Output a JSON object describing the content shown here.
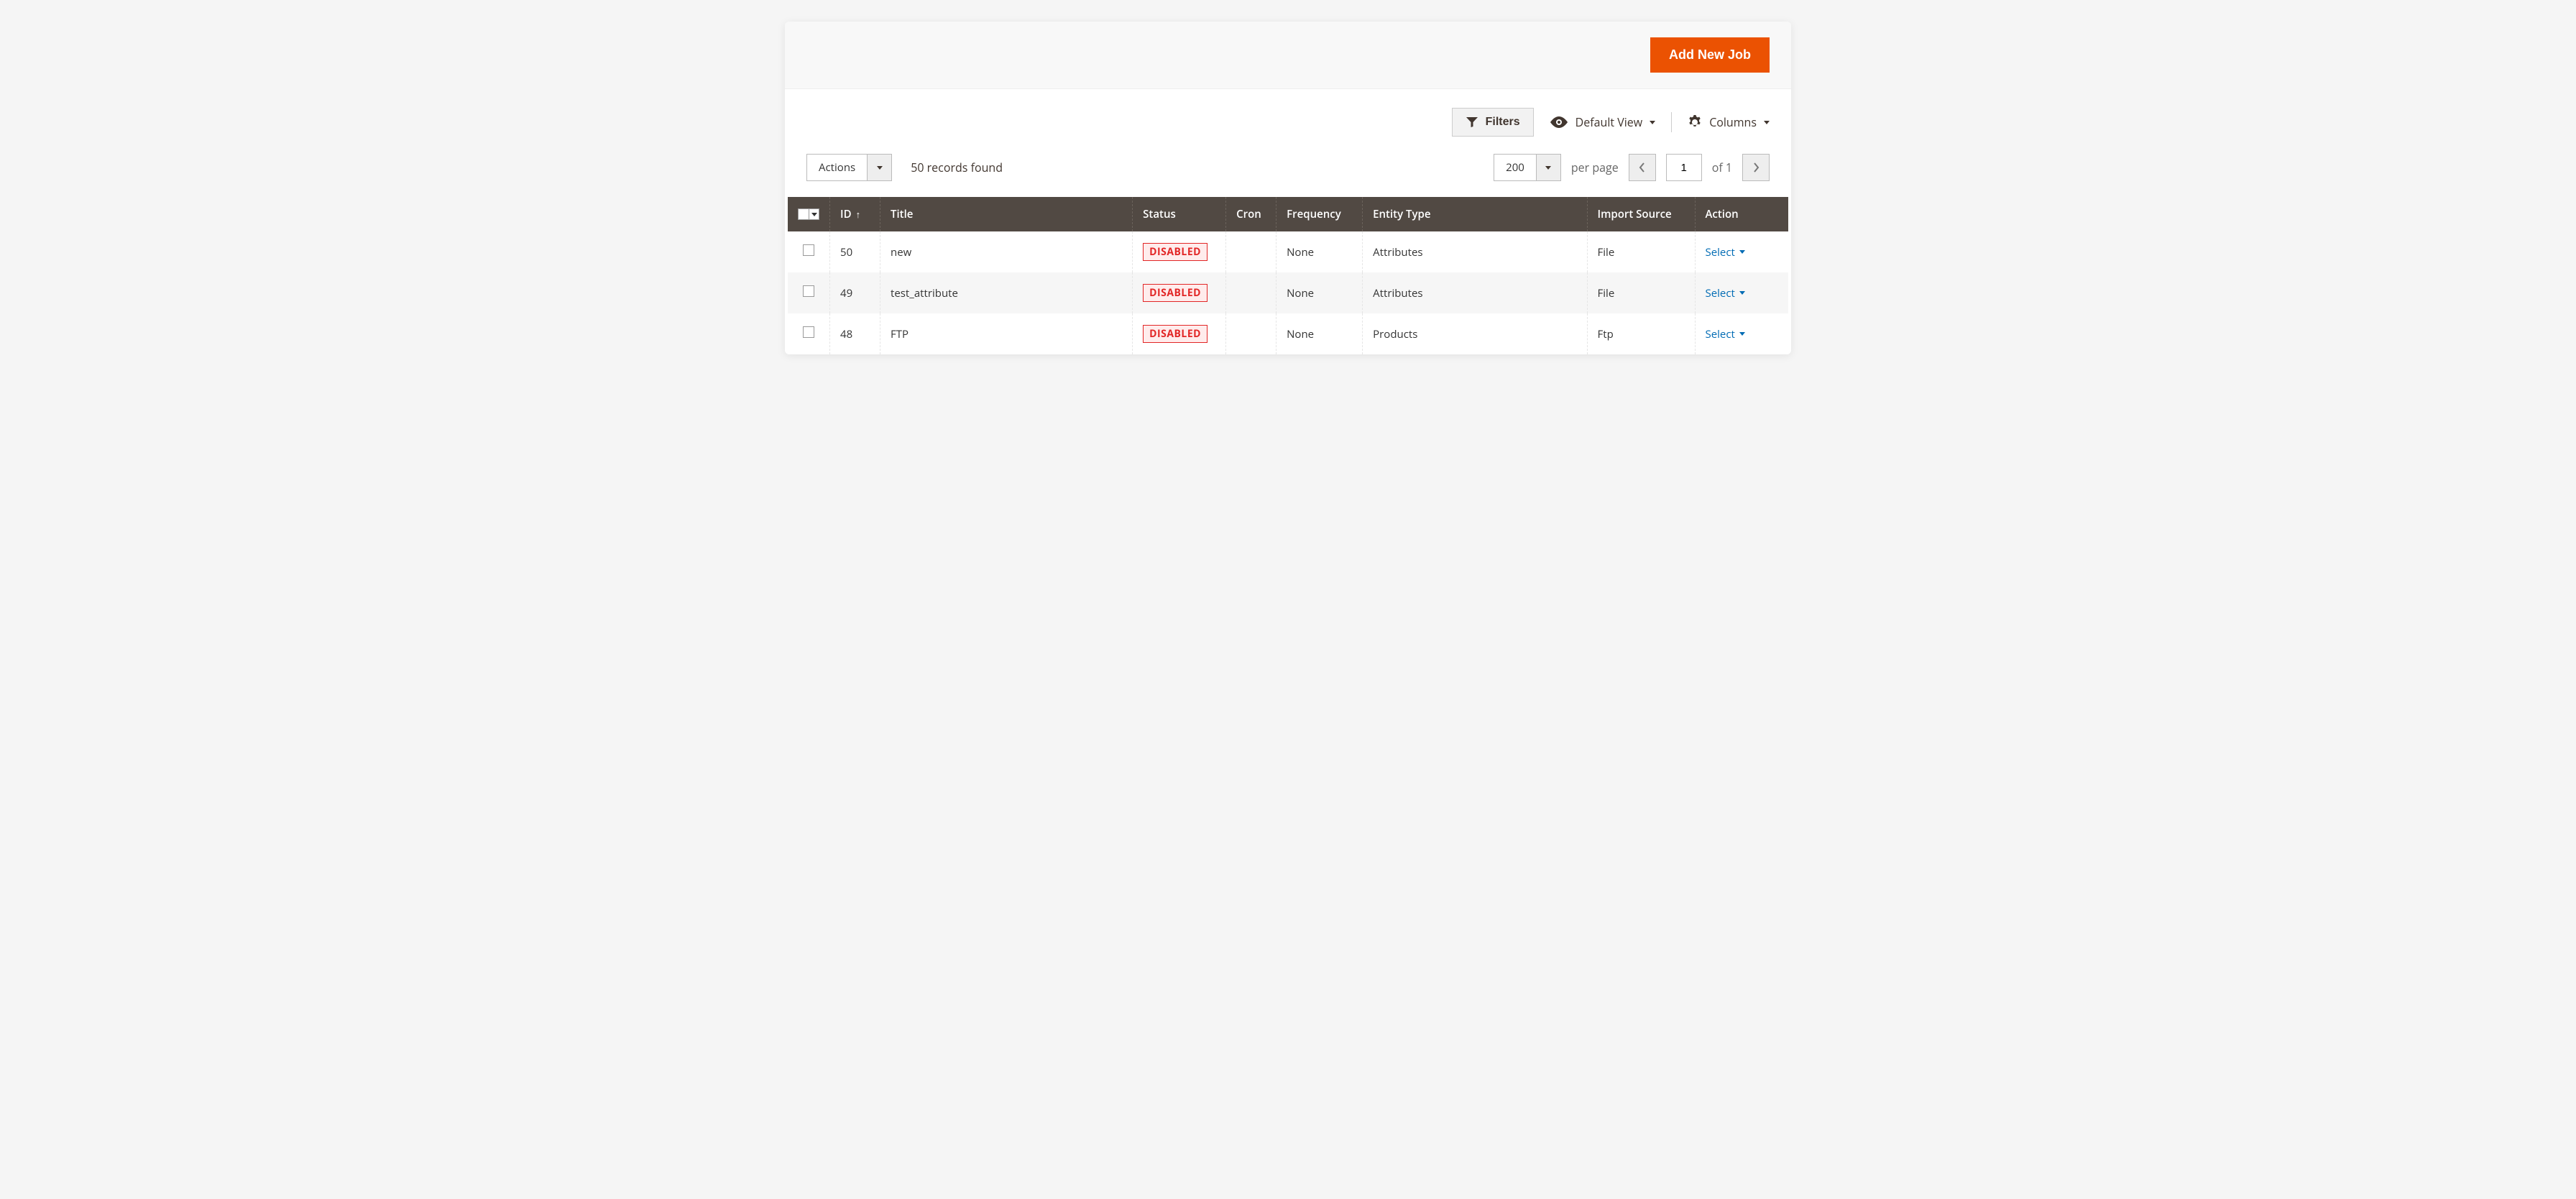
{
  "header": {
    "add_btn": "Add New Job"
  },
  "toolbar": {
    "filters": "Filters",
    "view_label": "Default View",
    "columns_label": "Columns"
  },
  "controls": {
    "actions_label": "Actions",
    "records_found": "50 records found",
    "page_size": "200",
    "per_page": "per page",
    "page": "1",
    "of": "of 1"
  },
  "table": {
    "headers": {
      "id": "ID",
      "title": "Title",
      "status": "Status",
      "cron": "Cron",
      "frequency": "Frequency",
      "entity": "Entity Type",
      "source": "Import Source",
      "action": "Action"
    },
    "rows": [
      {
        "id": "50",
        "title": "new",
        "status": "DISABLED",
        "cron": "",
        "frequency": "None",
        "entity": "Attributes",
        "source": "File",
        "action": "Select"
      },
      {
        "id": "49",
        "title": "test_attribute",
        "status": "DISABLED",
        "cron": "",
        "frequency": "None",
        "entity": "Attributes",
        "source": "File",
        "action": "Select"
      },
      {
        "id": "48",
        "title": "FTP",
        "status": "DISABLED",
        "cron": "",
        "frequency": "None",
        "entity": "Products",
        "source": "Ftp",
        "action": "Select"
      }
    ]
  }
}
